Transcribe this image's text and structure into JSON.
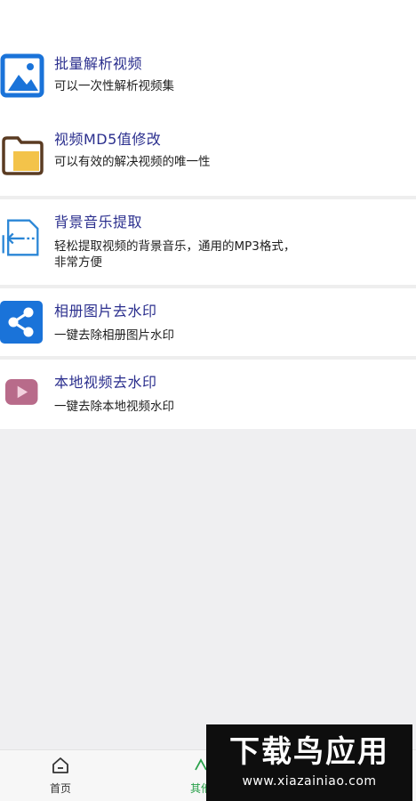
{
  "list": {
    "items": [
      {
        "title": "批量解析视频",
        "desc": "可以一次性解析视频集",
        "icon": "image-icon"
      },
      {
        "title": "视频MD5值修改",
        "desc": "可以有效的解决视频的唯一性",
        "icon": "folder-icon"
      },
      {
        "title": "背景音乐提取",
        "desc": "轻松提取视频的背景音乐，通用的MP3格式，",
        "desc2": "非常方便",
        "icon": "import-icon"
      },
      {
        "title": "相册图片去水印",
        "desc": "一键去除相册图片水印",
        "icon": "share-icon"
      },
      {
        "title": "本地视频去水印",
        "desc": "一键去除本地视频水印",
        "icon": "play-icon"
      }
    ]
  },
  "nav": {
    "home_label": "首页",
    "other_label": "其他"
  },
  "watermark": {
    "title": "下载鸟应用",
    "url": "www.xiazainiao.com"
  },
  "colors": {
    "title": "#2b2f8e",
    "blue_icon": "#1a73d9",
    "folder_icon": "#5a3b22",
    "folder_fill": "#f3c34a",
    "play_icon": "#b86b8a",
    "active_tab": "#2aa14b"
  }
}
